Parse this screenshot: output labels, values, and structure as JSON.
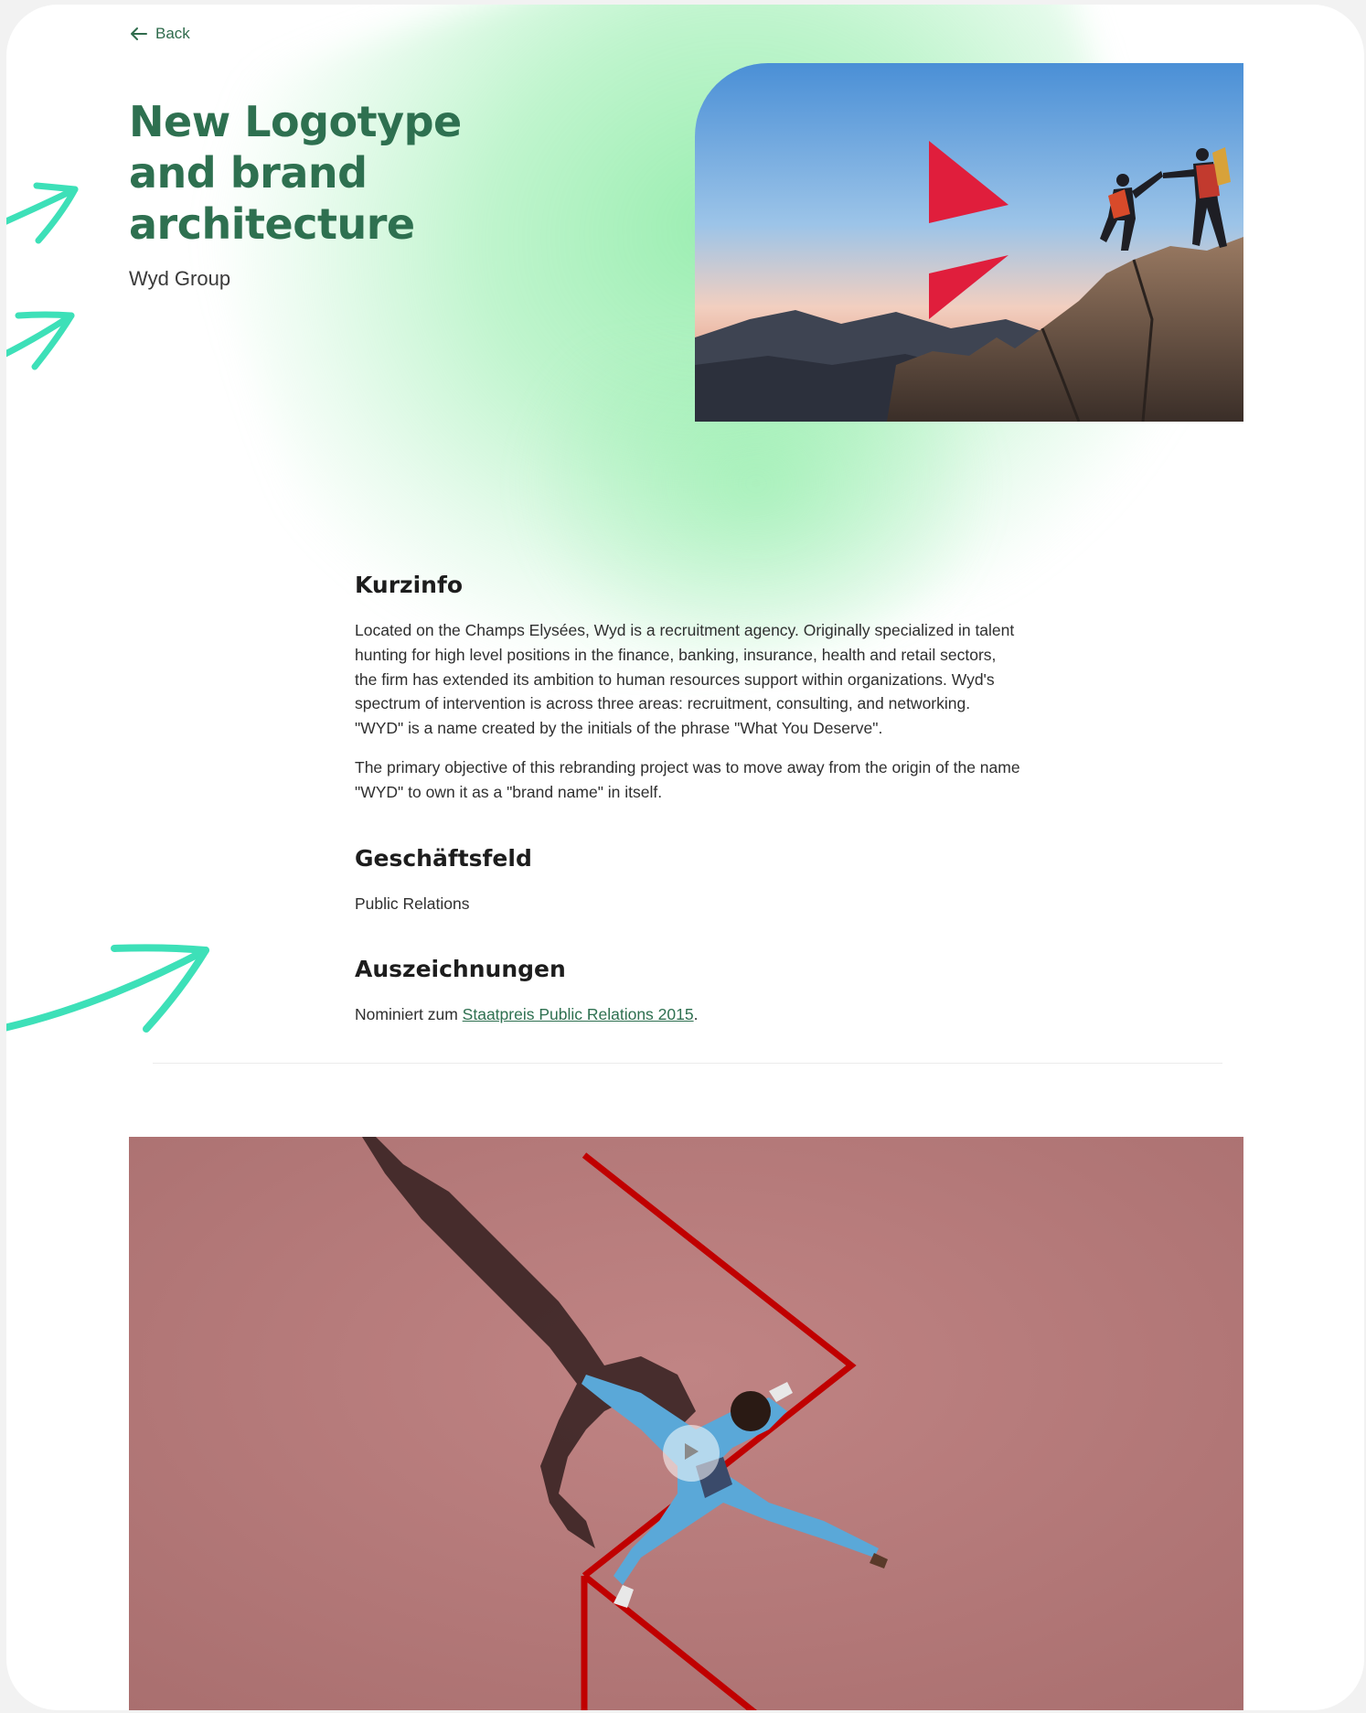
{
  "nav": {
    "back_label": "Back"
  },
  "hero": {
    "title": "New Logotype and brand architecture",
    "client": "Wyd Group"
  },
  "sections": {
    "kurzinfo": {
      "heading": "Kurzinfo",
      "paragraph_1": "Located on the Champs Elysées, Wyd is a recruitment agency. Originally specialized in talent hunting for high level positions in the finance, banking, insurance, health and retail sectors, the firm has extended its ambition to human resources support within organizations. Wyd's spectrum of intervention is across three areas: recruitment, consulting, and networking. \"WYD\" is a name created by the initials of the phrase \"What You Deserve\".",
      "paragraph_2": "The primary objective of this rebranding project was to move away from the origin of the name \"WYD\" to own it as a \"brand name\" in itself."
    },
    "geschaeftsfeld": {
      "heading": "Geschäftsfeld",
      "value": "Public Relations"
    },
    "auszeichnungen": {
      "heading": "Auszeichnungen",
      "prefix": "Nominiert zum ",
      "link_text": "Staatpreis Public Relations 2015",
      "suffix": "."
    }
  },
  "colors": {
    "brand_green": "#2e7050",
    "accent_mint": "#3de0b8",
    "brand_red": "#e01e3c",
    "video_bg": "#b77878"
  },
  "icons": {
    "back": "arrow-left-icon",
    "decor": "hand-drawn-arrow-icon",
    "play": "play-icon"
  }
}
